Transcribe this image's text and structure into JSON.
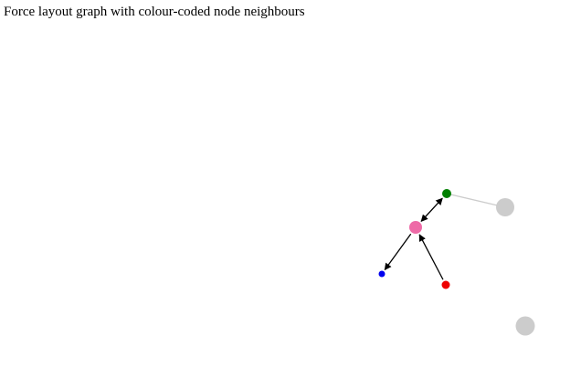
{
  "page": {
    "title": "Force layout graph with colour-coded node neighbours"
  },
  "graph": {
    "colors": {
      "edge_active": "#000000",
      "edge_inactive": "#cccccc",
      "node_inactive": "#cccccc"
    },
    "nodes": [
      {
        "id": "pink",
        "color": "#ee6aa7",
        "role": "selected"
      },
      {
        "id": "green",
        "color": "#008000",
        "role": "neighbour"
      },
      {
        "id": "blue",
        "color": "#0000ee",
        "role": "neighbour"
      },
      {
        "id": "red",
        "color": "#ee0000",
        "role": "neighbour"
      },
      {
        "id": "grey-a",
        "color": "#cccccc",
        "role": "other"
      },
      {
        "id": "grey-b",
        "color": "#cccccc",
        "role": "other"
      }
    ],
    "edges": [
      {
        "source": "pink",
        "target": "green",
        "arrow_start": true,
        "arrow_end": true
      },
      {
        "source": "pink",
        "target": "blue",
        "arrow_start": false,
        "arrow_end": true
      },
      {
        "source": "red",
        "target": "pink",
        "arrow_start": false,
        "arrow_end": true
      },
      {
        "source": "green",
        "target": "grey-a",
        "arrow_start": false,
        "arrow_end": false
      }
    ]
  }
}
